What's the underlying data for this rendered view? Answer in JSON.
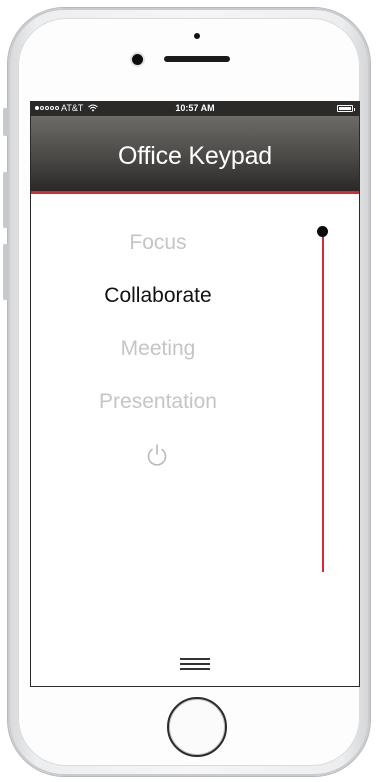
{
  "status_bar": {
    "signal_bars": 1,
    "carrier": "AT&T",
    "wifi_icon": "wifi-icon",
    "time": "10:57 AM",
    "battery_icon": "battery-full-icon",
    "battery_level": 1.0
  },
  "header": {
    "title": "Office Keypad",
    "accent_color": "#d62b35"
  },
  "scenes": [
    {
      "label": "Focus",
      "active": false
    },
    {
      "label": "Collaborate",
      "active": true
    },
    {
      "label": "Meeting",
      "active": false
    },
    {
      "label": "Presentation",
      "active": false
    }
  ],
  "power": {
    "icon": "power-icon"
  },
  "slider": {
    "level": 1.0
  },
  "footer": {
    "menu_icon": "hamburger-menu-icon"
  }
}
